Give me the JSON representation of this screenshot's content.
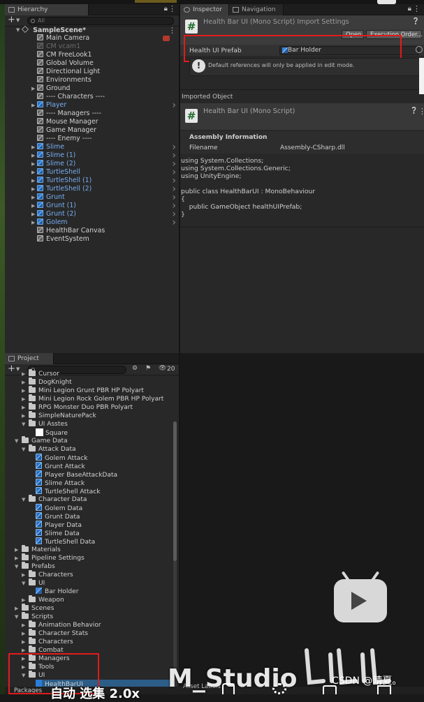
{
  "hierarchy": {
    "tab_label": "Hierarchy",
    "search_placeholder": "All",
    "scene_name": "SampleScene*",
    "items": [
      {
        "label": "Main Camera",
        "style": "normal"
      },
      {
        "label": "CM vcam1",
        "style": "dim"
      },
      {
        "label": "CM FreeLook1",
        "style": "normal"
      },
      {
        "label": "Global Volume",
        "style": "normal"
      },
      {
        "label": "Directional Light",
        "style": "normal"
      },
      {
        "label": "Environments",
        "style": "normal"
      },
      {
        "label": "Ground",
        "style": "normal"
      },
      {
        "label": "---- Characters ----",
        "style": "normal"
      },
      {
        "label": "Player",
        "style": "blue"
      },
      {
        "label": "---- Managers ----",
        "style": "normal"
      },
      {
        "label": "Mouse Manager",
        "style": "normal"
      },
      {
        "label": "Game Manager",
        "style": "normal"
      },
      {
        "label": "---- Enemy ----",
        "style": "normal"
      },
      {
        "label": "Slime",
        "style": "blue"
      },
      {
        "label": "Slime (1)",
        "style": "blue"
      },
      {
        "label": "Slime (2)",
        "style": "blue"
      },
      {
        "label": "TurtleShell",
        "style": "blue"
      },
      {
        "label": "TurtleShell (1)",
        "style": "blue"
      },
      {
        "label": "TurtleShell (2)",
        "style": "blue"
      },
      {
        "label": "Grunt",
        "style": "blue"
      },
      {
        "label": "Grunt (1)",
        "style": "blue"
      },
      {
        "label": "Grunt (2)",
        "style": "blue"
      },
      {
        "label": "Golem",
        "style": "blue"
      },
      {
        "label": "HealthBar Canvas",
        "style": "normal"
      },
      {
        "label": "EventSystem",
        "style": "normal"
      }
    ]
  },
  "inspector": {
    "tab_label": "Inspector",
    "nav_tab_label": "Navigation",
    "import_title": "Health Bar UI (Mono Script) Import Settings",
    "open_button": "Open",
    "execution_order_button": "Execution Order...",
    "field_label": "Health UI Prefab",
    "field_value": "Bar Holder",
    "info_text": "Default references will only be applied in edit mode.",
    "imported_object_label": "Imported Object",
    "object_title": "Health Bar UI (Mono Script)",
    "assembly_header": "Assembly Information",
    "filename_label": "Filename",
    "filename_value": "Assembly-CSharp.dll",
    "code_lines": [
      "using System.Collections;",
      "using System.Collections.Generic;",
      "using UnityEngine;",
      "",
      "public class HealthBarUI : MonoBehaviour",
      "{",
      "    public GameObject healthUIPrefab;",
      "}"
    ]
  },
  "project": {
    "tab_label": "Project",
    "hidden_count": "20",
    "items": [
      {
        "label": "Cursor",
        "icon": "folder",
        "depth": 2
      },
      {
        "label": "DogKnight",
        "icon": "folder",
        "depth": 2
      },
      {
        "label": "Mini Legion Grunt PBR HP Polyart",
        "icon": "folder",
        "depth": 2
      },
      {
        "label": "Mini Legion Rock Golem PBR HP Polyart",
        "icon": "folder",
        "depth": 2
      },
      {
        "label": "RPG Monster Duo PBR Polyart",
        "icon": "folder",
        "depth": 2
      },
      {
        "label": "SimpleNaturePack",
        "icon": "folder",
        "depth": 2
      },
      {
        "label": "UI Asstes",
        "icon": "folder",
        "depth": 2
      },
      {
        "label": "Square",
        "icon": "white-square",
        "depth": 3
      },
      {
        "label": "Game Data",
        "icon": "folder",
        "depth": 1
      },
      {
        "label": "Attack Data",
        "icon": "folder",
        "depth": 2
      },
      {
        "label": "Golem Attack",
        "icon": "so",
        "depth": 3
      },
      {
        "label": "Grunt Attack",
        "icon": "so",
        "depth": 3
      },
      {
        "label": "Player BaseAttackData",
        "icon": "so",
        "depth": 3
      },
      {
        "label": "Slime Attack",
        "icon": "so",
        "depth": 3
      },
      {
        "label": "TurtleShell Attack",
        "icon": "so",
        "depth": 3
      },
      {
        "label": "Character Data",
        "icon": "folder",
        "depth": 2
      },
      {
        "label": "Golem Data",
        "icon": "so",
        "depth": 3
      },
      {
        "label": "Grunt Data",
        "icon": "so",
        "depth": 3
      },
      {
        "label": "Player Data",
        "icon": "so",
        "depth": 3
      },
      {
        "label": "Slime Data",
        "icon": "so",
        "depth": 3
      },
      {
        "label": "TurtleShell Data",
        "icon": "so",
        "depth": 3
      },
      {
        "label": "Materials",
        "icon": "folder",
        "depth": 1
      },
      {
        "label": "Pipeline Settings",
        "icon": "folder",
        "depth": 1
      },
      {
        "label": "Prefabs",
        "icon": "folder",
        "depth": 1
      },
      {
        "label": "Characters",
        "icon": "folder",
        "depth": 2
      },
      {
        "label": "UI",
        "icon": "folder",
        "depth": 2
      },
      {
        "label": "Bar Holder",
        "icon": "prefab",
        "depth": 3
      },
      {
        "label": "Weapon",
        "icon": "folder",
        "depth": 2
      },
      {
        "label": "Scenes",
        "icon": "folder",
        "depth": 1
      },
      {
        "label": "Scripts",
        "icon": "folder",
        "depth": 1
      },
      {
        "label": "Animation Behavior",
        "icon": "folder",
        "depth": 2
      },
      {
        "label": "Character Stats",
        "icon": "folder",
        "depth": 2
      },
      {
        "label": "Characters",
        "icon": "folder",
        "depth": 2
      },
      {
        "label": "Combat",
        "icon": "folder",
        "depth": 2
      },
      {
        "label": "Managers",
        "icon": "folder",
        "depth": 2
      },
      {
        "label": "Tools",
        "icon": "folder",
        "depth": 2
      },
      {
        "label": "UI",
        "icon": "folder",
        "depth": 2
      },
      {
        "label": "HealthBarUI",
        "icon": "cs",
        "depth": 3
      }
    ]
  },
  "bottom_bar": {
    "packages_label": "Packages",
    "asset_labels": "Asset Labels"
  },
  "overlay": {
    "studio_watermark": "M_Studio",
    "csdn_watermark": "CSDN @晴夏。",
    "subtitle_chars": "自动  选集  2.0x"
  },
  "colors": {
    "highlight_red": "#e21b1b",
    "prefab_blue": "#78aef2",
    "panel_bg": "#282828"
  }
}
